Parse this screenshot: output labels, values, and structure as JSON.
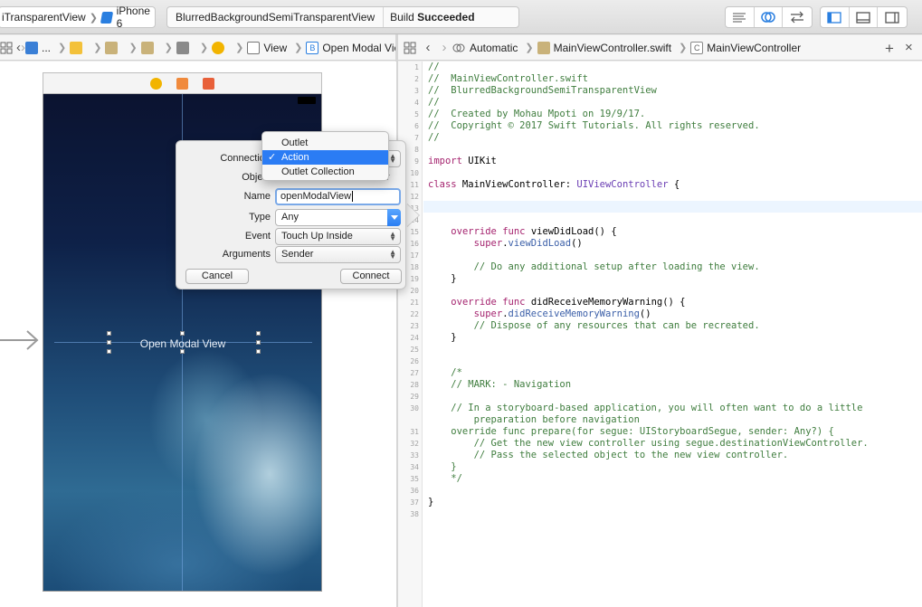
{
  "toolbar": {
    "scheme_target": "iTransparentView",
    "scheme_device": "iPhone 6",
    "project_name": "BlurredBackgroundSemiTransparentView",
    "build_status_prefix": "Build ",
    "build_status_result": "Succeeded"
  },
  "left_jumpbar": {
    "ellipsis": "...",
    "view_label": "View",
    "button_label": "Open Modal View"
  },
  "right_jumpbar": {
    "mode": "Automatic",
    "file": "MainViewController.swift",
    "class": "MainViewController",
    "add": "+",
    "close": "×"
  },
  "scene": {
    "button_text": "Open Modal View"
  },
  "connection_popover": {
    "connection_label": "Connection",
    "object_label": "Object",
    "object_value_tail": "r",
    "name_label": "Name",
    "name_value": "openModalView",
    "type_label": "Type",
    "type_value": "Any",
    "event_label": "Event",
    "event_value": "Touch Up Inside",
    "arguments_label": "Arguments",
    "arguments_value": "Sender",
    "cancel": "Cancel",
    "connect": "Connect",
    "menu": [
      "Outlet",
      "Action",
      "Outlet Collection"
    ],
    "menu_selected": "Action",
    "check": "✓"
  },
  "code": {
    "line_numbers": [
      "1",
      "2",
      "3",
      "4",
      "5",
      "6",
      "7",
      "8",
      "9",
      "10",
      "11",
      "12",
      "13",
      "14",
      "15",
      "16",
      "17",
      "18",
      "19",
      "20",
      "21",
      "22",
      "23",
      "24",
      "25",
      "26",
      "27",
      "28",
      "29",
      "30",
      "",
      "31",
      "32",
      "33",
      "34",
      "35",
      "36",
      "37",
      "38"
    ],
    "lines": [
      [
        {
          "t": "//",
          "c": "com"
        }
      ],
      [
        {
          "t": "//  MainViewController.swift",
          "c": "com"
        }
      ],
      [
        {
          "t": "//  BlurredBackgroundSemiTransparentView",
          "c": "com"
        }
      ],
      [
        {
          "t": "//",
          "c": "com"
        }
      ],
      [
        {
          "t": "//  Created by Mohau Mpoti on 19/9/17.",
          "c": "com"
        }
      ],
      [
        {
          "t": "//  Copyright © 2017 Swift Tutorials. All rights reserved.",
          "c": "com"
        }
      ],
      [
        {
          "t": "//",
          "c": "com"
        }
      ],
      [],
      [
        {
          "t": "import",
          "c": "kw"
        },
        {
          "t": " UIKit",
          "c": ""
        }
      ],
      [],
      [
        {
          "t": "class",
          "c": "kw"
        },
        {
          "t": " MainViewController: ",
          "c": ""
        },
        {
          "t": "UIViewController",
          "c": "type"
        },
        {
          "t": " {",
          "c": ""
        }
      ],
      [],
      [],
      [],
      [
        {
          "t": "    ",
          "c": ""
        },
        {
          "t": "override",
          "c": "kw"
        },
        {
          "t": " ",
          "c": ""
        },
        {
          "t": "func",
          "c": "kw"
        },
        {
          "t": " viewDidLoad() {",
          "c": ""
        }
      ],
      [
        {
          "t": "        ",
          "c": ""
        },
        {
          "t": "super",
          "c": "kw"
        },
        {
          "t": ".",
          "c": ""
        },
        {
          "t": "viewDidLoad",
          "c": "call"
        },
        {
          "t": "()",
          "c": ""
        }
      ],
      [],
      [
        {
          "t": "        // Do any additional setup after loading the view.",
          "c": "com"
        }
      ],
      [
        {
          "t": "    }",
          "c": ""
        }
      ],
      [],
      [
        {
          "t": "    ",
          "c": ""
        },
        {
          "t": "override",
          "c": "kw"
        },
        {
          "t": " ",
          "c": ""
        },
        {
          "t": "func",
          "c": "kw"
        },
        {
          "t": " didReceiveMemoryWarning() {",
          "c": ""
        }
      ],
      [
        {
          "t": "        ",
          "c": ""
        },
        {
          "t": "super",
          "c": "kw"
        },
        {
          "t": ".",
          "c": ""
        },
        {
          "t": "didReceiveMemoryWarning",
          "c": "call"
        },
        {
          "t": "()",
          "c": ""
        }
      ],
      [
        {
          "t": "        // Dispose of any resources that can be recreated.",
          "c": "com"
        }
      ],
      [
        {
          "t": "    }",
          "c": ""
        }
      ],
      [],
      [],
      [
        {
          "t": "    /*",
          "c": "com"
        }
      ],
      [
        {
          "t": "    // MARK: - Navigation",
          "c": "com"
        }
      ],
      [],
      [
        {
          "t": "    // In a storyboard-based application, you will often want to do a little",
          "c": "com"
        }
      ],
      [
        {
          "t": "        preparation before navigation",
          "c": "com"
        }
      ],
      [
        {
          "t": "    override func prepare(for segue: UIStoryboardSegue, sender: Any?) {",
          "c": "com"
        }
      ],
      [
        {
          "t": "        // Get the new view controller using segue.destinationViewController.",
          "c": "com"
        }
      ],
      [
        {
          "t": "        // Pass the selected object to the new view controller.",
          "c": "com"
        }
      ],
      [
        {
          "t": "    }",
          "c": "com"
        }
      ],
      [
        {
          "t": "    */",
          "c": "com"
        }
      ],
      [],
      [
        {
          "t": "}",
          "c": ""
        }
      ],
      []
    ]
  }
}
